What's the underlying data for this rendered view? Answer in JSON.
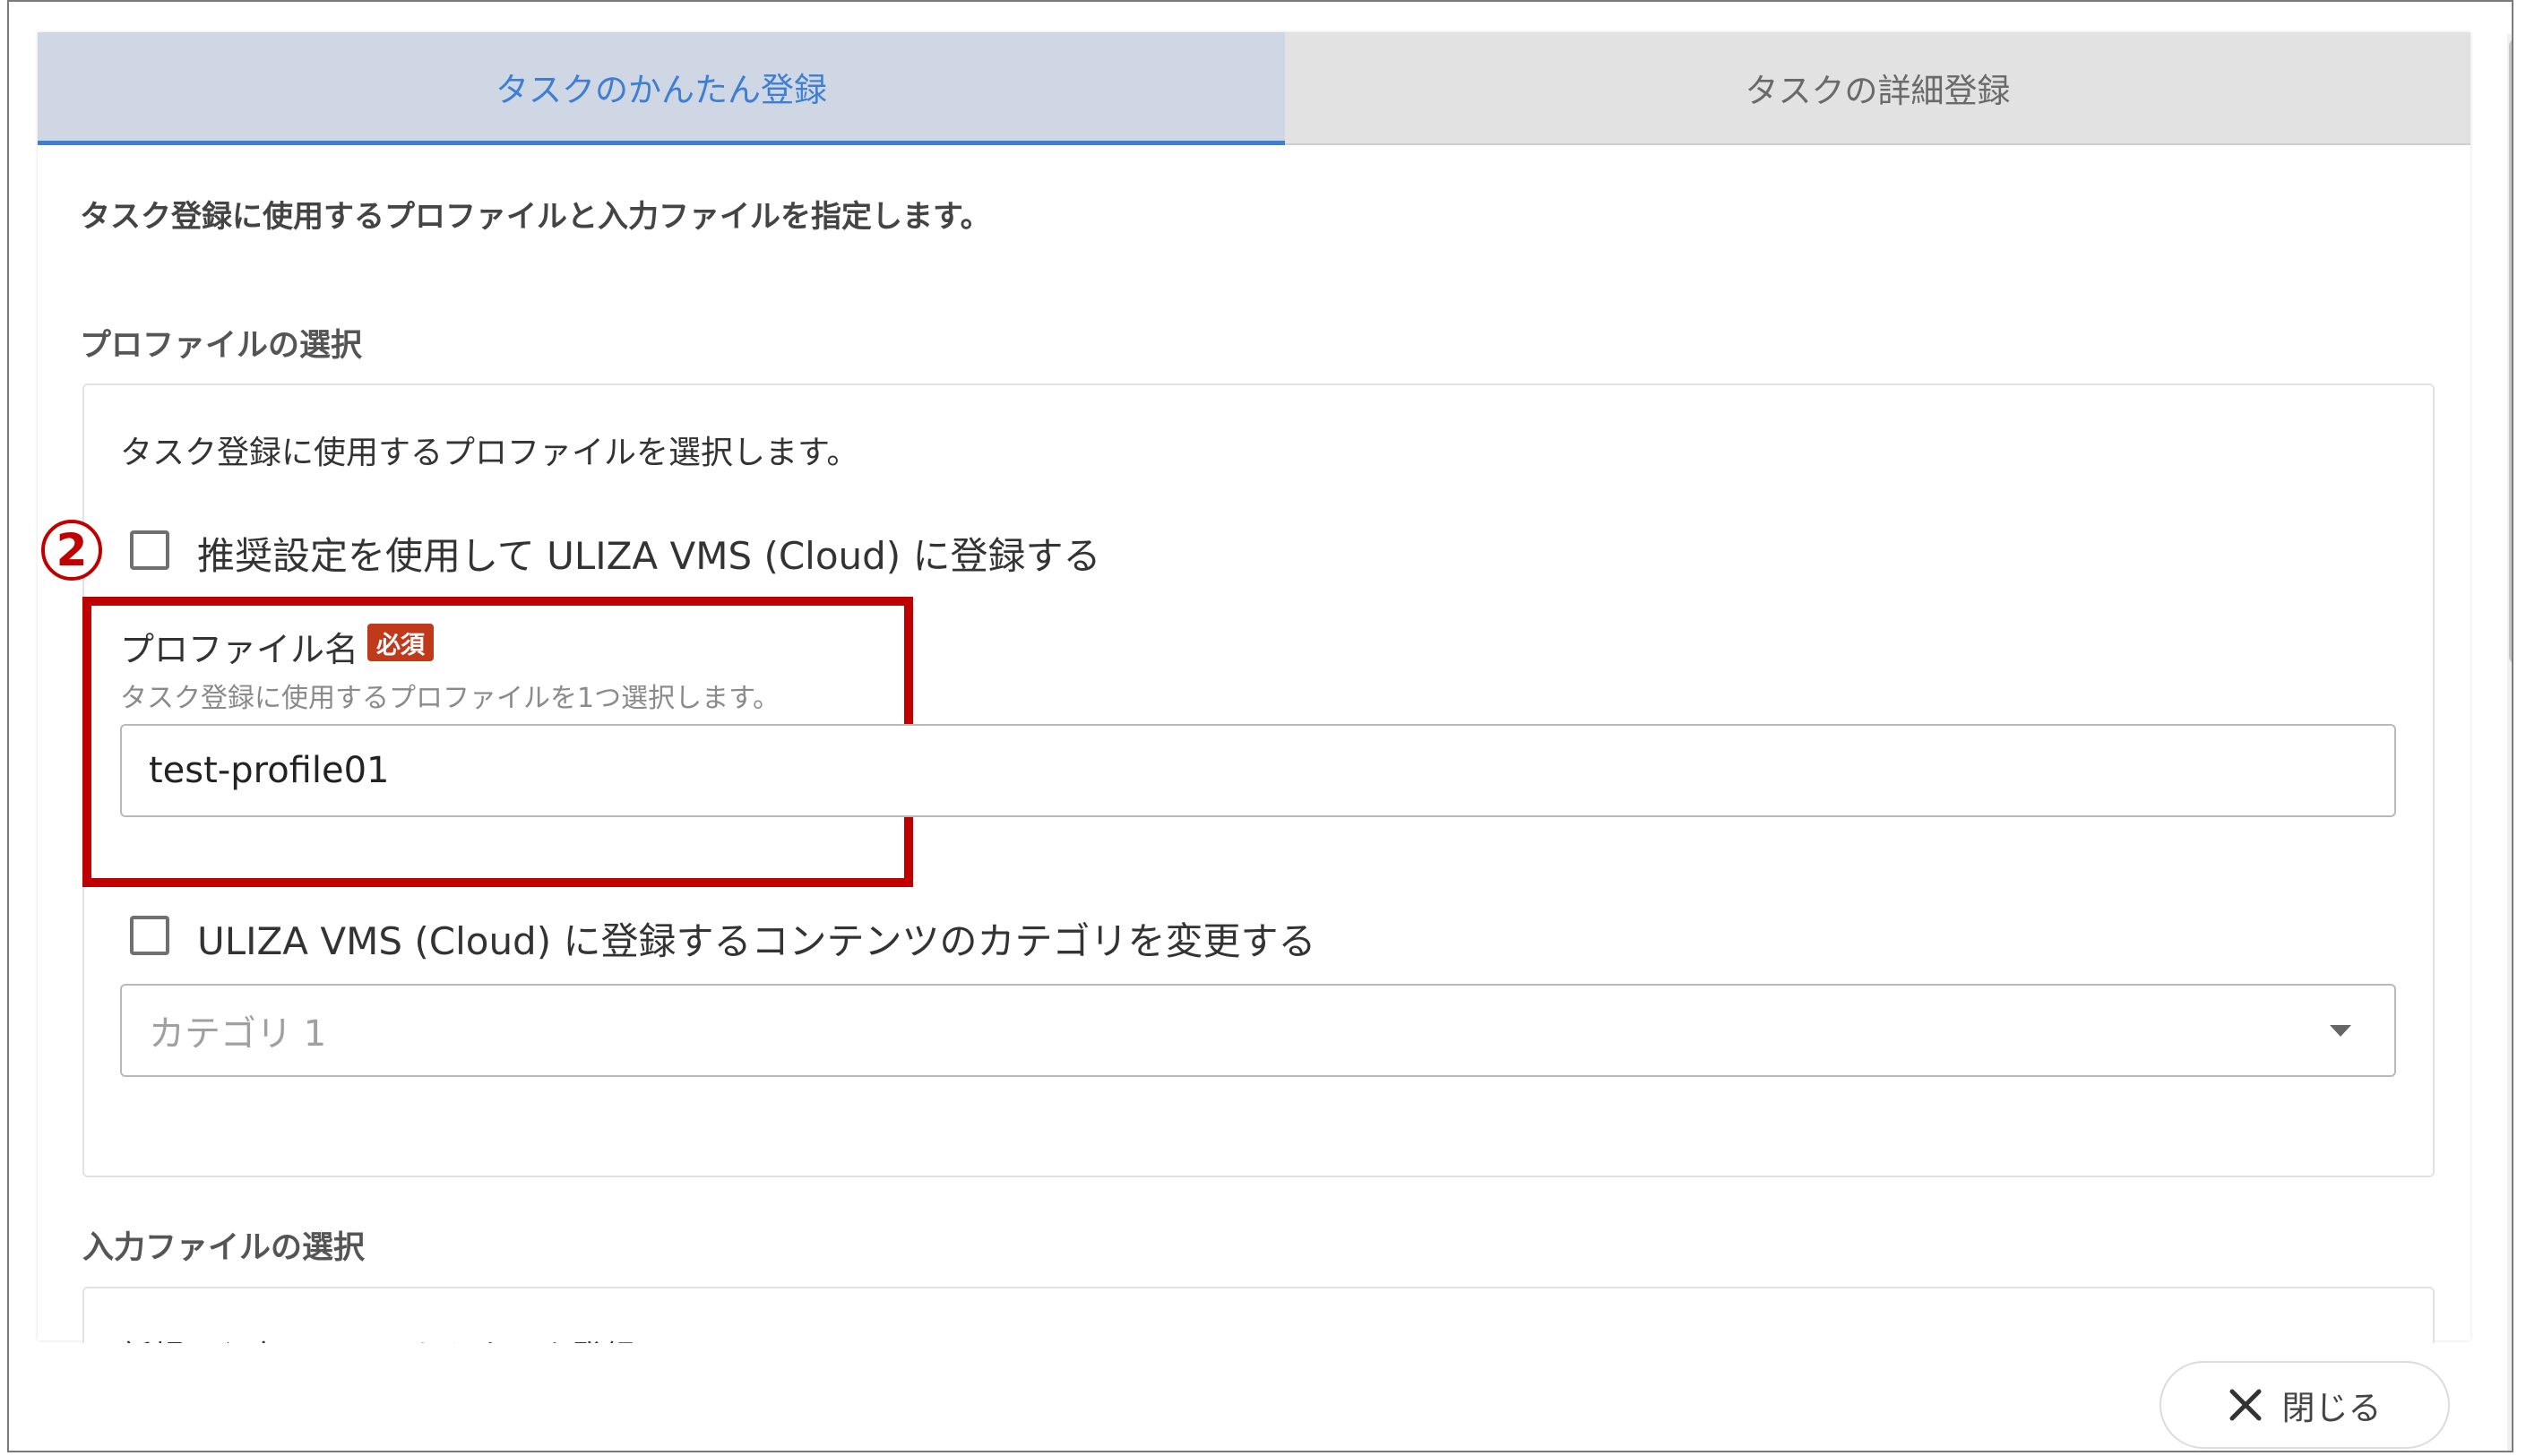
{
  "tabs": [
    {
      "label": "タスクのかんたん登録",
      "active": true
    },
    {
      "label": "タスクの詳細登録",
      "active": false
    }
  ],
  "intro": "タスク登録に使用するプロファイルと入力ファイルを指定します。",
  "profile_section": {
    "title": "プロファイルの選択",
    "description": "タスク登録に使用するプロファイルを選択します。",
    "recommend_checkbox": {
      "label": "推奨設定を使用して ULIZA VMS (Cloud) に登録する",
      "checked": false
    },
    "profile_field": {
      "label": "プロファイル名",
      "required_badge": "必須",
      "hint": "タスク登録に使用するプロファイルを1つ選択します。",
      "value": "test-profile01"
    },
    "category_checkbox": {
      "label": "ULIZA VMS (Cloud) に登録するコンテンツのカテゴリを変更する",
      "checked": false
    },
    "category_select": {
      "placeholder": "カテゴリ 1"
    }
  },
  "annotation": {
    "step_number": "2"
  },
  "input_section": {
    "title": "入力ファイルの選択",
    "partial_text": "新規の入力ファイルからタスク登録"
  },
  "footer": {
    "close_label": "閉じる"
  },
  "colors": {
    "accent": "#3f7fd3",
    "highlight": "#c00000",
    "badge": "#c0391b"
  },
  "icons": {
    "close": "close-icon",
    "dropdown": "caret-down-icon"
  }
}
